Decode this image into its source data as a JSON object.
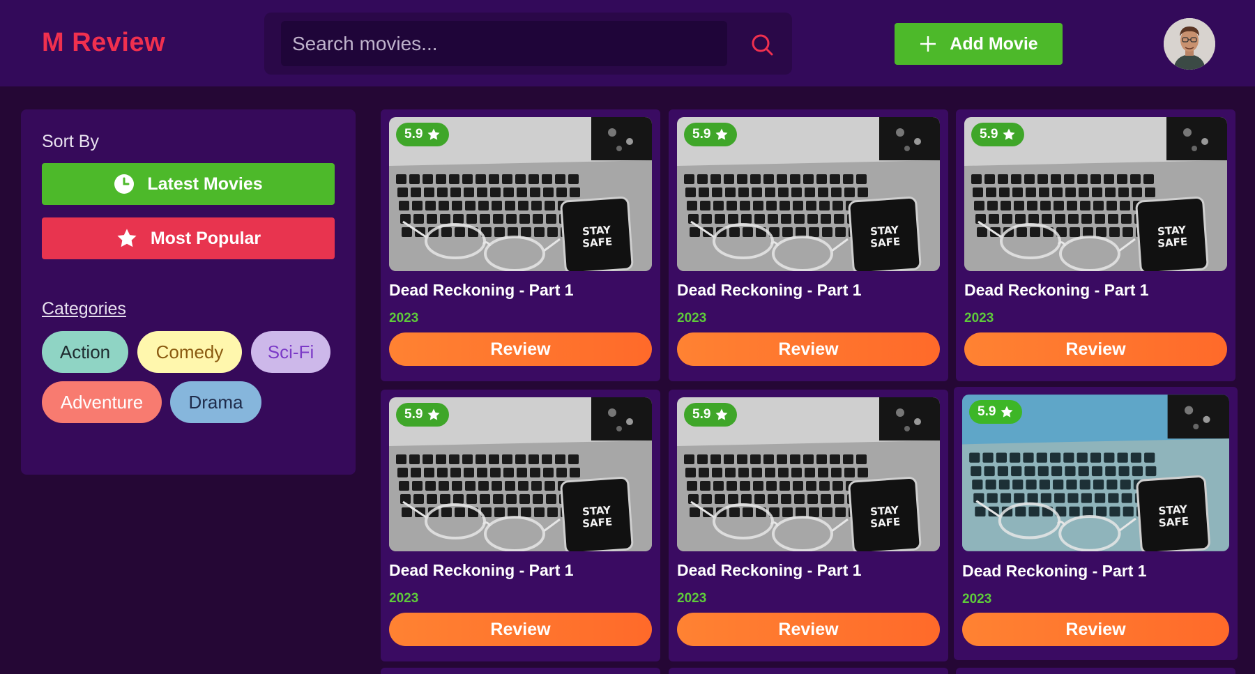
{
  "header": {
    "logo": "M Review",
    "search_placeholder": "Search movies...",
    "add_movie_label": "Add Movie"
  },
  "sidebar": {
    "sort_title": "Sort By",
    "latest_label": "Latest Movies",
    "popular_label": "Most Popular",
    "categories_title": "Categories",
    "categories": [
      {
        "label": "Action",
        "bg": "#8fd4c4",
        "fg": "#1e2b2f"
      },
      {
        "label": "Comedy",
        "bg": "#fff7ad",
        "fg": "#8a5a10"
      },
      {
        "label": "Sci-Fi",
        "bg": "#cdb8ea",
        "fg": "#7b3ac7"
      },
      {
        "label": "Adventure",
        "bg": "#f87b70",
        "fg": "#ffffff"
      },
      {
        "label": "Drama",
        "bg": "#86b6dc",
        "fg": "#1e2b4a"
      }
    ]
  },
  "movies": [
    {
      "title": "Dead Reckoning - Part 1",
      "year": "2023",
      "rating": "5.9",
      "review_label": "Review",
      "poster_text": "STAY SAFE"
    },
    {
      "title": "Dead Reckoning - Part 1",
      "year": "2023",
      "rating": "5.9",
      "review_label": "Review",
      "poster_text": "STAY SAFE"
    },
    {
      "title": "Dead Reckoning - Part 1",
      "year": "2023",
      "rating": "5.9",
      "review_label": "Review",
      "poster_text": "STAY SAFE"
    },
    {
      "title": "Dead Reckoning - Part 1",
      "year": "2023",
      "rating": "5.9",
      "review_label": "Review",
      "poster_text": "STAY SAFE"
    },
    {
      "title": "Dead Reckoning - Part 1",
      "year": "2023",
      "rating": "5.9",
      "review_label": "Review",
      "poster_text": "STAY SAFE"
    },
    {
      "title": "Dead Reckoning - Part 1",
      "year": "2023",
      "rating": "5.9",
      "review_label": "Review",
      "poster_text": "STAY SAFE"
    }
  ],
  "colors": {
    "accent_green": "#4db92a",
    "accent_red": "#e8344f",
    "review_orange": "#ff7a2f",
    "header_bg": "#330a5a",
    "page_bg": "#250735"
  }
}
